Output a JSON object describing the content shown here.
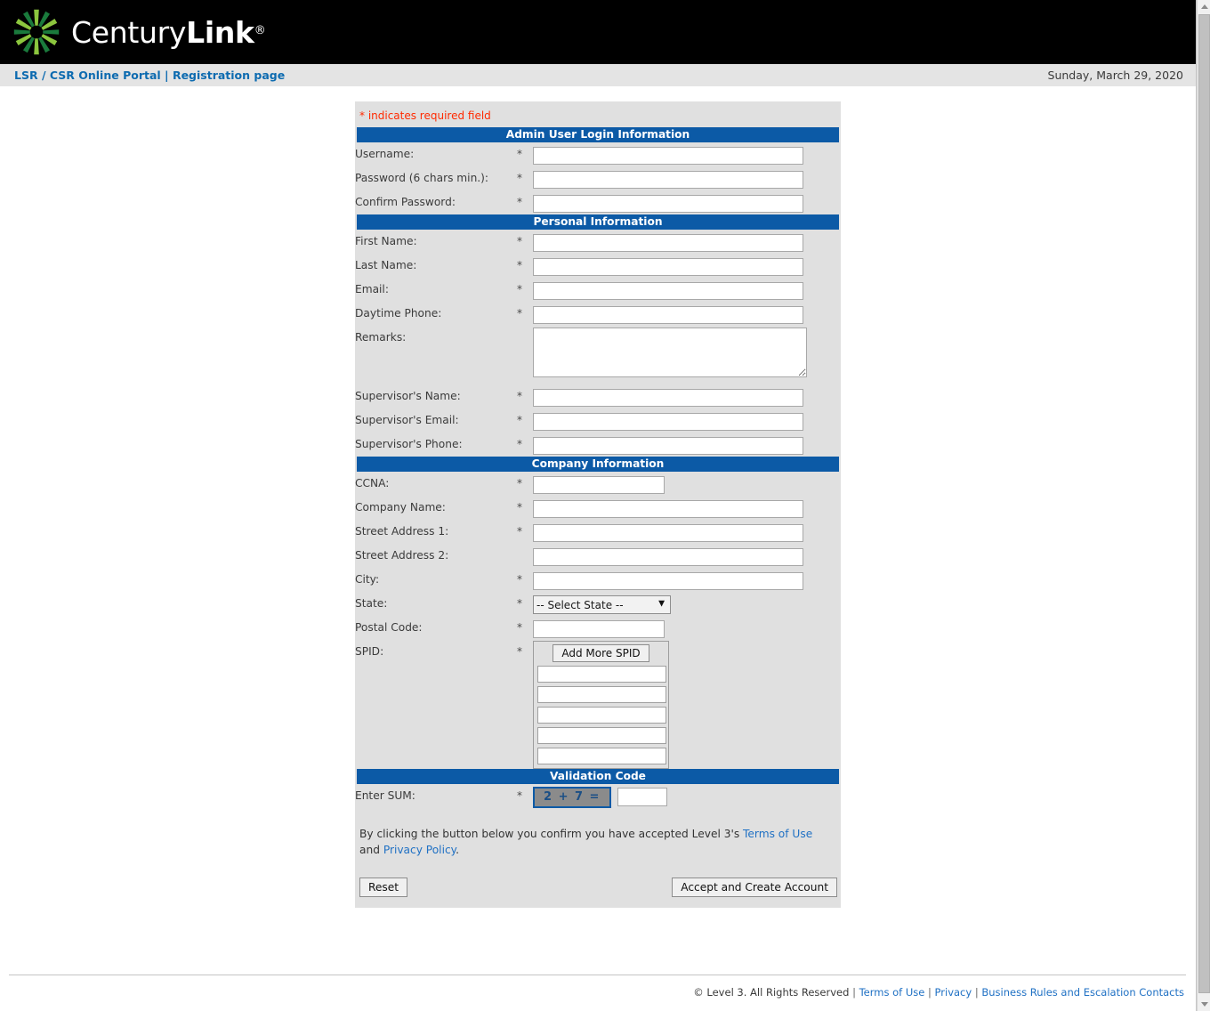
{
  "brand": {
    "name_thin": "Century",
    "name_bold": "Link",
    "registered_mark": "®",
    "logo_icon": "centurylink-sunburst-logo",
    "colors": {
      "header_bg": "#000000",
      "light_green": "#8cc63e",
      "dark_green": "#1a7a3c",
      "section_blue": "#0c5aa6",
      "link_blue": "#2071c4",
      "crumb_blue": "#0d6bb0",
      "required_red": "#ff2a00",
      "panel_gray": "#e0e0e0"
    }
  },
  "breadcrumb": {
    "text": "LSR / CSR Online Portal | Registration page"
  },
  "header": {
    "date": "Sunday, March 29, 2020"
  },
  "form": {
    "required_note": "* indicates required field",
    "required_star": "*",
    "sections": {
      "admin_login": {
        "title": "Admin User Login Information",
        "fields": [
          {
            "label": "Username:",
            "value": "",
            "required": true
          },
          {
            "label": "Password (6 chars min.):",
            "value": "",
            "required": true
          },
          {
            "label": "Confirm Password:",
            "value": "",
            "required": true
          }
        ]
      },
      "personal": {
        "title": "Personal Information",
        "fields": [
          {
            "label": "First Name:",
            "value": "",
            "required": true
          },
          {
            "label": "Last Name:",
            "value": "",
            "required": true
          },
          {
            "label": "Email:",
            "value": "",
            "required": true
          },
          {
            "label": "Daytime Phone:",
            "value": "",
            "required": true
          },
          {
            "label": "Remarks:",
            "value": "",
            "required": false
          },
          {
            "label": "Supervisor's Name:",
            "value": "",
            "required": true
          },
          {
            "label": "Supervisor's Email:",
            "value": "",
            "required": true
          },
          {
            "label": "Supervisor's Phone:",
            "value": "",
            "required": true
          }
        ]
      },
      "company": {
        "title": "Company Information",
        "fields": [
          {
            "label": "CCNA:",
            "value": "",
            "required": true
          },
          {
            "label": "Company Name:",
            "value": "",
            "required": true
          },
          {
            "label": "Street Address 1:",
            "value": "",
            "required": true
          },
          {
            "label": "Street Address 2:",
            "value": "",
            "required": false
          },
          {
            "label": "City:",
            "value": "",
            "required": true
          },
          {
            "label": "State:",
            "value": "",
            "required": true
          },
          {
            "label": "Postal Code:",
            "value": "",
            "required": true
          },
          {
            "label": "SPID:",
            "value": "",
            "required": true
          }
        ],
        "state_select": {
          "selected": "-- Select State --",
          "caret_icon": "chevron-down-icon"
        },
        "spid": {
          "add_button_label": "Add More SPID",
          "inputs": [
            "",
            "",
            "",
            "",
            ""
          ]
        }
      },
      "validation": {
        "title": "Validation Code",
        "field_label": "Enter SUM:",
        "captcha_text": "2 + 7 =",
        "captcha_answer": ""
      }
    },
    "terms": {
      "prefix": "By clicking the button below you confirm you have accepted Level 3's ",
      "link1": "Terms of Use",
      "middle": " and ",
      "link2": "Privacy Policy",
      "suffix": "."
    },
    "buttons": {
      "reset": "Reset",
      "submit": "Accept and Create Account"
    }
  },
  "footer": {
    "copyright": "© Level 3. All Rights Reserved",
    "separator": "|",
    "links": [
      "Terms of Use",
      "Privacy",
      "Business Rules and Escalation Contacts"
    ]
  }
}
